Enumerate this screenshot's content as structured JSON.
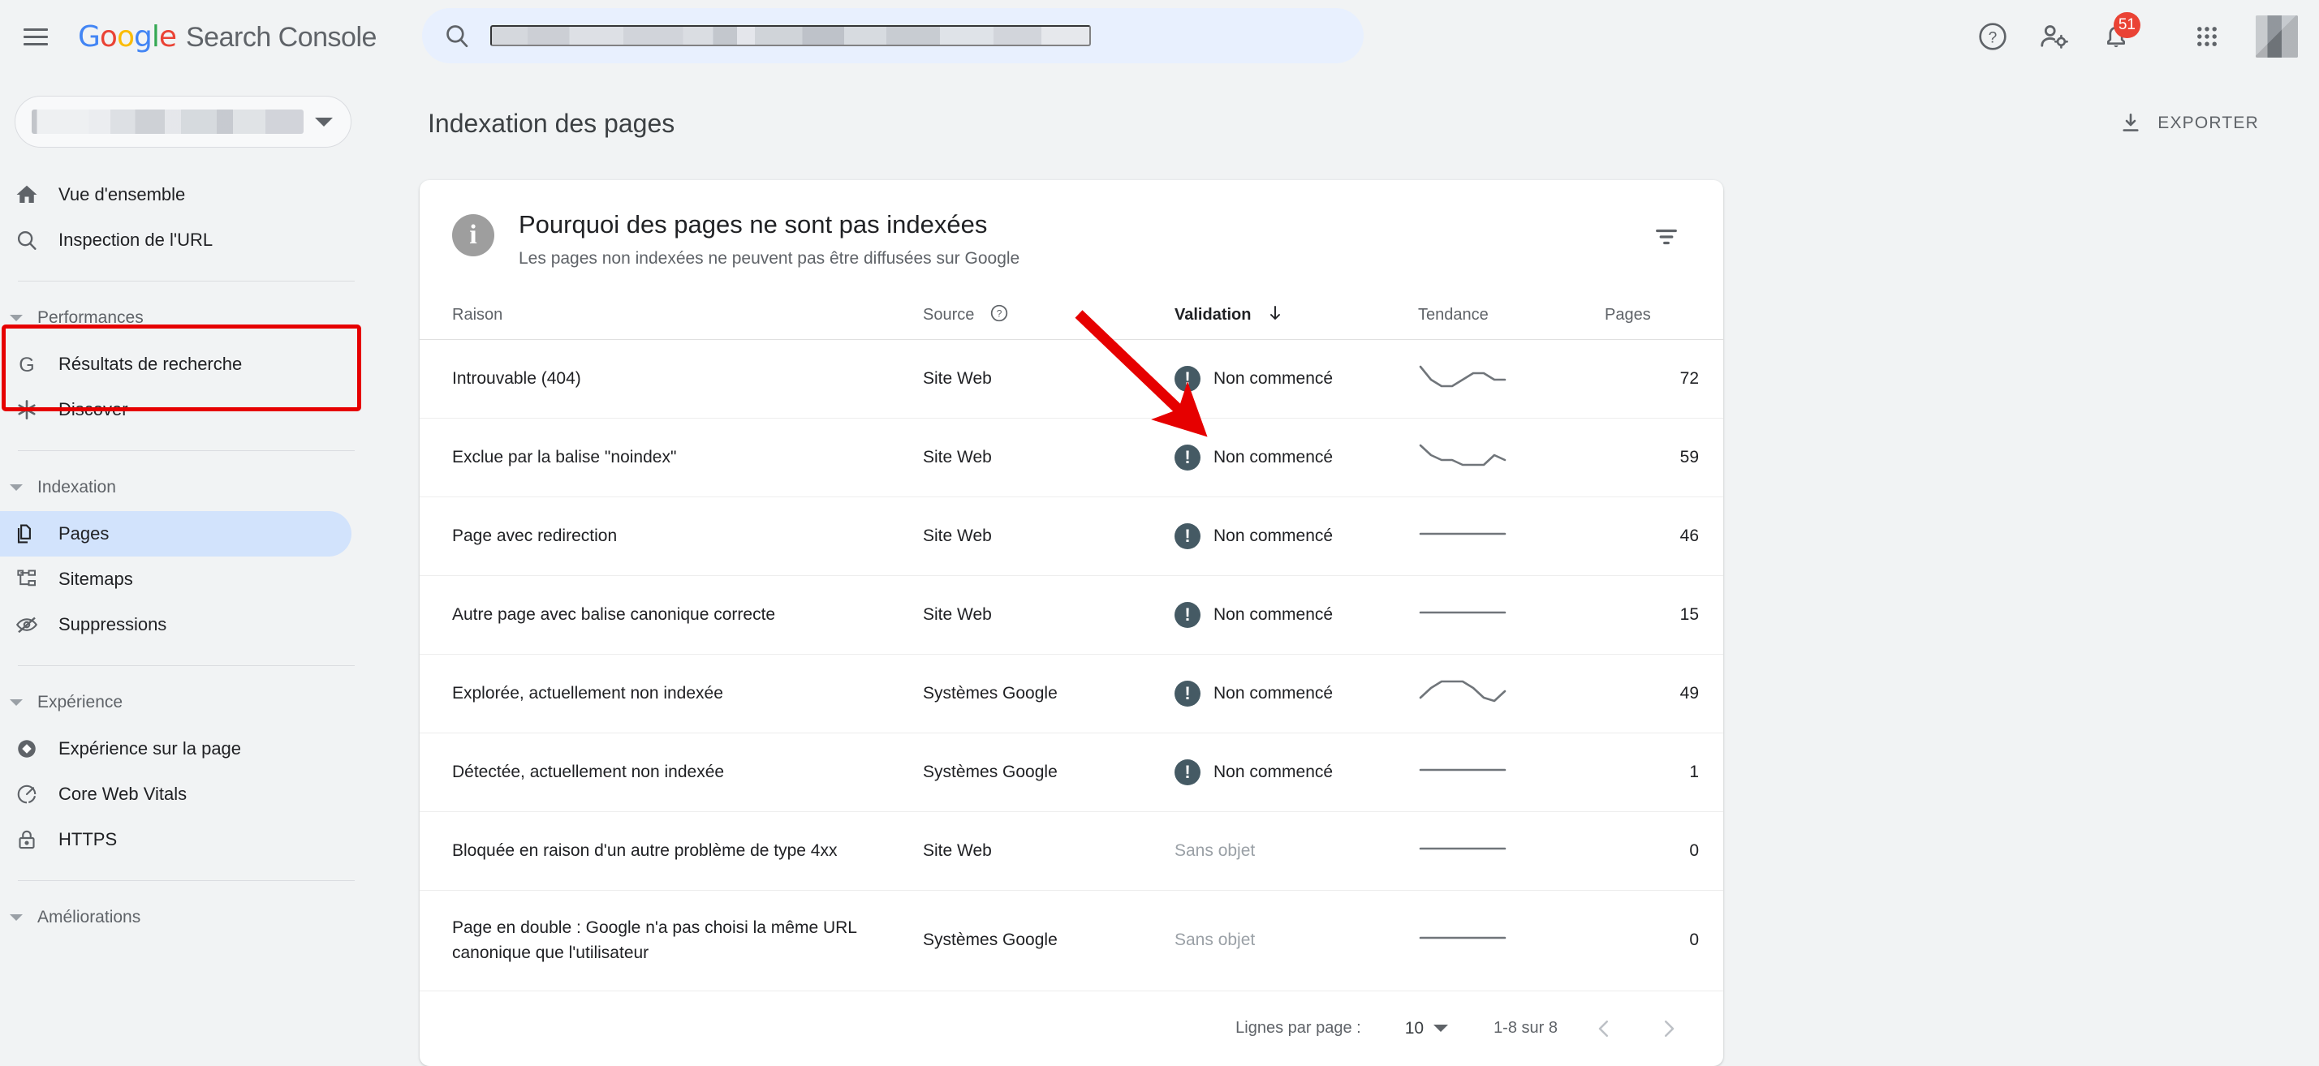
{
  "header": {
    "menu_icon": "hamburger-menu-icon",
    "brand_google": "Google",
    "brand_product": "Search Console",
    "search": {
      "icon": "search-icon",
      "value": "",
      "placeholder": ""
    },
    "help_icon": "help-circle-icon",
    "users_icon": "user-settings-icon",
    "notifications_icon": "bell-icon",
    "notifications_count": "51",
    "apps_icon": "apps-grid-icon",
    "avatar": "user-avatar"
  },
  "sidebar": {
    "property_selector": {
      "value": "",
      "caret": "chevron-down-icon"
    },
    "items": [
      {
        "label": "Vue d'ensemble",
        "icon": "home-icon",
        "active": false
      },
      {
        "label": "Inspection de l'URL",
        "icon": "search-icon",
        "active": false
      }
    ],
    "groups": [
      {
        "label": "Performances",
        "items": [
          {
            "label": "Résultats de recherche",
            "icon": "google-g-icon",
            "active": false
          },
          {
            "label": "Discover",
            "icon": "asterisk-icon",
            "active": false
          }
        ]
      },
      {
        "label": "Indexation",
        "items": [
          {
            "label": "Pages",
            "icon": "pages-copy-icon",
            "active": true
          },
          {
            "label": "Sitemaps",
            "icon": "sitemap-icon",
            "active": false
          },
          {
            "label": "Suppressions",
            "icon": "eye-off-icon",
            "active": false
          }
        ]
      },
      {
        "label": "Expérience",
        "items": [
          {
            "label": "Expérience sur la page",
            "icon": "page-experience-icon",
            "active": false
          },
          {
            "label": "Core Web Vitals",
            "icon": "speedometer-icon",
            "active": false
          },
          {
            "label": "HTTPS",
            "icon": "lock-icon",
            "active": false
          }
        ]
      },
      {
        "label": "Améliorations",
        "items": []
      }
    ]
  },
  "main": {
    "page_title": "Indexation des pages",
    "export_label": "EXPORTER",
    "export_icon": "download-icon"
  },
  "card": {
    "info_icon": "info-circle-icon",
    "title": "Pourquoi des pages ne sont pas indexées",
    "subtitle": "Les pages non indexées ne peuvent pas être diffusées sur Google",
    "filter_icon": "filter-list-icon",
    "columns": [
      {
        "key": "reason",
        "label": "Raison",
        "sorted": false,
        "help": false
      },
      {
        "key": "source",
        "label": "Source",
        "sorted": false,
        "help": true,
        "help_icon": "help-circle-icon"
      },
      {
        "key": "validation",
        "label": "Validation",
        "sorted": true,
        "help": false,
        "sort_icon": "arrow-down-icon"
      },
      {
        "key": "trend",
        "label": "Tendance",
        "sorted": false,
        "help": false
      },
      {
        "key": "pages",
        "label": "Pages",
        "sorted": false,
        "help": false
      }
    ],
    "rows": [
      {
        "reason": "Introuvable (404)",
        "source": "Site Web",
        "validation": "Non commencé",
        "validation_state": "not-started",
        "pages": "72"
      },
      {
        "reason": "Exclue par la balise \"noindex\"",
        "source": "Site Web",
        "validation": "Non commencé",
        "validation_state": "not-started",
        "pages": "59"
      },
      {
        "reason": "Page avec redirection",
        "source": "Site Web",
        "validation": "Non commencé",
        "validation_state": "not-started",
        "pages": "46"
      },
      {
        "reason": "Autre page avec balise canonique correcte",
        "source": "Site Web",
        "validation": "Non commencé",
        "validation_state": "not-started",
        "pages": "15"
      },
      {
        "reason": "Explorée, actuellement non indexée",
        "source": "Systèmes Google",
        "validation": "Non commencé",
        "validation_state": "not-started",
        "pages": "49"
      },
      {
        "reason": "Détectée, actuellement non indexée",
        "source": "Systèmes Google",
        "validation": "Non commencé",
        "validation_state": "not-started",
        "pages": "1"
      },
      {
        "reason": "Bloquée en raison d'un autre problème de type 4xx",
        "source": "Site Web",
        "validation": "Sans objet",
        "validation_state": "na",
        "pages": "0"
      },
      {
        "reason": "Page en double : Google n'a pas choisi la même URL canonique que l'utilisateur",
        "source": "Systèmes Google",
        "validation": "Sans objet",
        "validation_state": "na",
        "pages": "0"
      }
    ],
    "footer": {
      "rows_per_page_label": "Lignes par page :",
      "rows_per_page_value": "10",
      "range": "1-8 sur 8",
      "prev_icon": "chevron-left-icon",
      "next_icon": "chevron-right-icon"
    }
  },
  "chart_data": {
    "type": "line",
    "title": "Tendance (sparklines par ligne)",
    "grid": false,
    "legend": null,
    "series": [
      {
        "name": "Introuvable (404)",
        "values": [
          72,
          70,
          69,
          69,
          70,
          71,
          71,
          70,
          70
        ]
      },
      {
        "name": "Exclue par la balise \"noindex\"",
        "values": [
          62,
          60,
          59,
          59,
          58,
          58,
          58,
          60,
          59
        ]
      },
      {
        "name": "Page avec redirection",
        "values": [
          46,
          46,
          46,
          46,
          46,
          46,
          46,
          46,
          46
        ]
      },
      {
        "name": "Autre page avec balise canonique correcte",
        "values": [
          15,
          15,
          15,
          15,
          15,
          15,
          15,
          15,
          15
        ]
      },
      {
        "name": "Explorée, actuellement non indexée",
        "values": [
          47,
          50,
          52,
          52,
          52,
          50,
          47,
          46,
          49
        ]
      },
      {
        "name": "Détectée, actuellement non indexée",
        "values": [
          1,
          1,
          1,
          1,
          1,
          1,
          1,
          1,
          1
        ]
      },
      {
        "name": "Bloquée en raison d'un autre problème de type 4xx",
        "values": [
          0,
          0,
          0,
          0,
          0,
          0,
          0,
          0,
          0
        ]
      },
      {
        "name": "Page en double : Google n'a pas choisi la même URL canonique que l'utilisateur",
        "values": [
          0,
          0,
          0,
          0,
          0,
          0,
          0,
          0,
          0
        ]
      }
    ]
  },
  "annotations": {
    "arrow_color": "#e60000",
    "box_color": "#e60000",
    "arrow_target": "Raison",
    "box_target": "Indexation / Pages"
  },
  "colors": {
    "accent_blue": "#4285f4",
    "google_red": "#ea4335",
    "google_yellow": "#fbbc05",
    "google_green": "#34a853",
    "status_slate": "#455a64",
    "active_nav": "#d2e3fc",
    "page_bg": "#f1f3f4",
    "annotation_red": "#e60000"
  }
}
